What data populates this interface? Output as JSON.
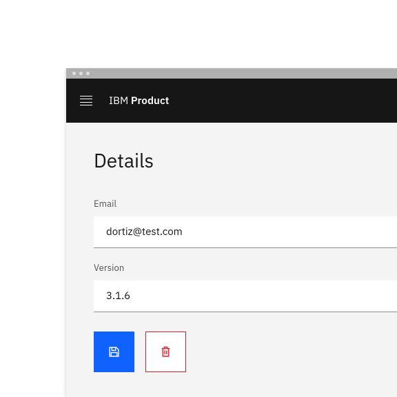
{
  "brand": {
    "prefix": "IBM",
    "name": "Product"
  },
  "page": {
    "title": "Details"
  },
  "fields": {
    "email": {
      "label": "Email",
      "value": "dortiz@test.com"
    },
    "version": {
      "label": "Version",
      "value": "3.1.6"
    }
  },
  "colors": {
    "primary": "#0f62fe",
    "danger": "#da1e28",
    "header": "#161616"
  }
}
